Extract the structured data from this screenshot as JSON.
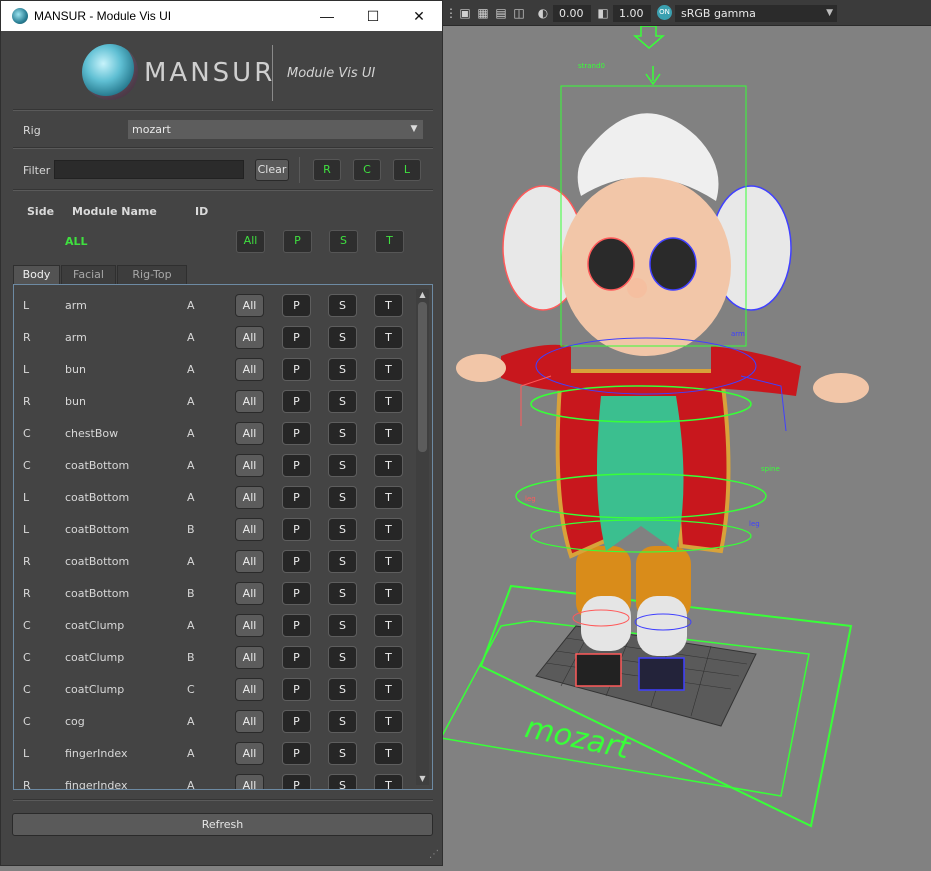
{
  "window": {
    "title": "MANSUR - Module Vis UI",
    "minimize": "—",
    "maximize": "☐",
    "close": "✕"
  },
  "logo": {
    "brand": "MANSUR",
    "subtitle": "Module Vis UI"
  },
  "rig": {
    "label": "Rig",
    "value": "mozart"
  },
  "filter": {
    "label": "Filter",
    "value": "",
    "clear": "Clear",
    "r": "R",
    "c": "C",
    "l": "L"
  },
  "header": {
    "side": "Side",
    "module": "Module Name",
    "id": "ID",
    "all_label": "ALL",
    "all": "All",
    "p": "P",
    "s": "S",
    "t": "T"
  },
  "tabs": [
    "Body",
    "Facial",
    "Rig-Top"
  ],
  "rows": [
    {
      "side": "L",
      "name": "arm",
      "id": "A"
    },
    {
      "side": "R",
      "name": "arm",
      "id": "A"
    },
    {
      "side": "L",
      "name": "bun",
      "id": "A"
    },
    {
      "side": "R",
      "name": "bun",
      "id": "A"
    },
    {
      "side": "C",
      "name": "chestBow",
      "id": "A"
    },
    {
      "side": "C",
      "name": "coatBottom",
      "id": "A"
    },
    {
      "side": "L",
      "name": "coatBottom",
      "id": "A"
    },
    {
      "side": "L",
      "name": "coatBottom",
      "id": "B"
    },
    {
      "side": "R",
      "name": "coatBottom",
      "id": "A"
    },
    {
      "side": "R",
      "name": "coatBottom",
      "id": "B"
    },
    {
      "side": "C",
      "name": "coatClump",
      "id": "A"
    },
    {
      "side": "C",
      "name": "coatClump",
      "id": "B"
    },
    {
      "side": "C",
      "name": "coatClump",
      "id": "C"
    },
    {
      "side": "C",
      "name": "cog",
      "id": "A"
    },
    {
      "side": "L",
      "name": "fingerIndex",
      "id": "A"
    },
    {
      "side": "R",
      "name": "fingerIndex",
      "id": "A"
    }
  ],
  "row_buttons": {
    "all": "All",
    "p": "P",
    "s": "S",
    "t": "T"
  },
  "refresh": "Refresh",
  "viewport": {
    "field1": "0.00",
    "field2": "1.00",
    "colorspace": "sRGB gamma",
    "on_badge": "ON",
    "labels": {
      "rig_name": "mozart",
      "spine": "spine",
      "leg_l": "leg",
      "leg_r": "leg",
      "arm": "arm",
      "strand": "strand0"
    }
  }
}
